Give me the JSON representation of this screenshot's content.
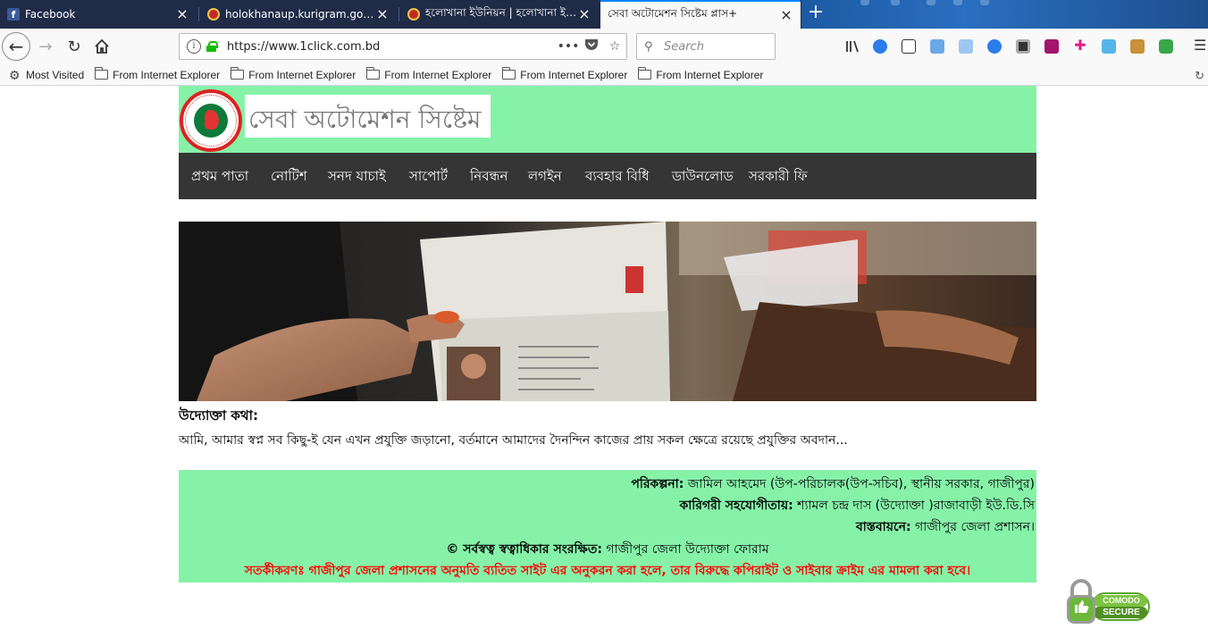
{
  "browser": {
    "tabs": [
      {
        "label": "Facebook",
        "favicon": "facebook-icon"
      },
      {
        "label": "holokhanaup.kurigram.gov.bd/",
        "favicon": "govt-seal-icon"
      },
      {
        "label": "হলোখানা ইউনিয়ন | হলোখানা ইউনিয়",
        "favicon": "govt-seal-icon"
      },
      {
        "label": "সেবা অটোমেশন সিষ্টেম প্লাস+",
        "favicon": "none"
      }
    ],
    "active_tab": 3,
    "new_tab_label": "+",
    "url": "https://www.1click.com.bd",
    "page_actions_label": "•••",
    "search_placeholder": "Search",
    "bookmarks": [
      {
        "label": "Most Visited",
        "icon": "gear-icon"
      },
      {
        "label": "From Internet Explorer",
        "icon": "folder-icon"
      },
      {
        "label": "From Internet Explorer",
        "icon": "folder-icon"
      },
      {
        "label": "From Internet Explorer",
        "icon": "folder-icon"
      },
      {
        "label": "From Internet Explorer",
        "icon": "folder-icon"
      },
      {
        "label": "From Internet Explorer",
        "icon": "folder-icon"
      }
    ],
    "colors": {
      "tabbar": "#1f2b47",
      "active_tab_accent": "#0a84ff",
      "lock": "#12bc00"
    }
  },
  "site": {
    "title": "সেবা অটোমেশন সিষ্টেম",
    "menu": [
      "প্রথম পাতা",
      "নোটিশ",
      "সনদ যাচাই",
      "সাপোর্ট",
      "নিবন্ধন",
      "লগইন",
      "ব্যবহার বিধি",
      "ডাউনলোড",
      "সরকারী ফি"
    ],
    "uddokta_title": "উদ্যোক্তা কথা:",
    "uddokta_text": "আমি, আমার স্বপ্ন সব কিছু-ই যেন এখন প্রযুক্তি জড়ানো, বর্তমানে আমাদের দৈনন্দিন কাজের প্রায় সকল ক্ষেত্রে রয়েছে প্রযুক্তির অবদান...",
    "footer": {
      "plan_label": "পরিকল্পনা:",
      "plan_value": "জামিল আহমেদ (উপ-পরিচালক(উপ-সচিব), স্থানীয় সরকার, গাজীপুর)",
      "tech_label": "কারিগরী সহযোগীতায়:",
      "tech_value": "শ্যামল চন্দ্র দাস (উদ্যোক্তা )রাজাবাড়ী ইউ.ডি.সি",
      "impl_label": "বাস্তবায়নে:",
      "impl_value": "গাজীপুর জেলা প্রশাসন।",
      "copyright_label": "© সর্বস্বত্ব স্বত্বাধিকার সংরক্ষিত:",
      "copyright_value": "গাজীপুর জেলা উদ্যোক্তা ফোরাম",
      "warning": "সতর্কীকরণঃ গাজীপুর জেলা প্রশাসনের অনুমতি ব্যতিত সাইট এর অনুকরন করা হলে, তার বিরুদ্ধে কপিরাইট ও সাইবার ক্রাইম এর মামলা করা হবে।"
    },
    "comodo_top": "COMODO",
    "comodo_bottom": "SECURE",
    "colors": {
      "header_bg": "#86f2a8",
      "menu_bg": "#353535",
      "warning": "#ff0000"
    }
  }
}
